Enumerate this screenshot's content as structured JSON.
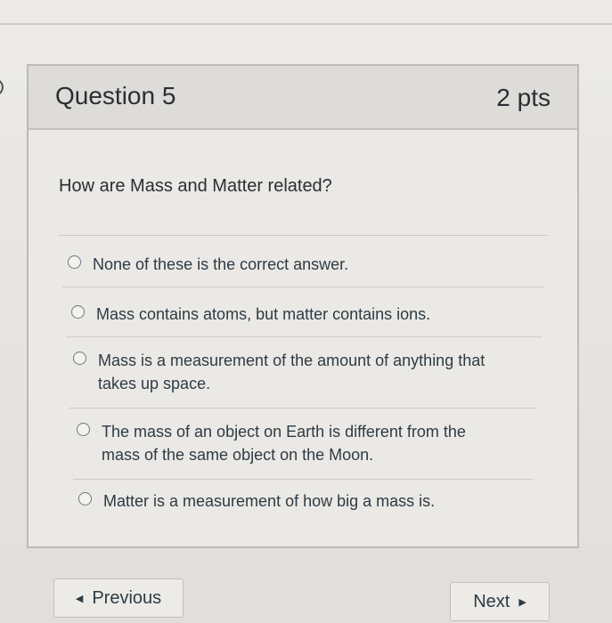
{
  "question": {
    "title": "Question 5",
    "points": "2 pts",
    "text": "How are Mass and Matter related?",
    "answers": [
      {
        "label": "None of these is the correct answer."
      },
      {
        "label": "Mass contains atoms, but matter contains ions."
      },
      {
        "label": "Mass is a measurement of the amount of anything that takes up space."
      },
      {
        "label": "The mass of an object on Earth is different from the mass of the same object on the Moon."
      },
      {
        "label": "Matter is a measurement of how big a mass is."
      }
    ]
  },
  "navigation": {
    "previous_label": "Previous",
    "next_label": "Next",
    "prev_icon": "triangle-left-icon",
    "next_icon": "triangle-right-icon"
  },
  "colors": {
    "text": "#2d3b45",
    "header_bg": "#dedcd8",
    "border": "#bdbab5"
  }
}
